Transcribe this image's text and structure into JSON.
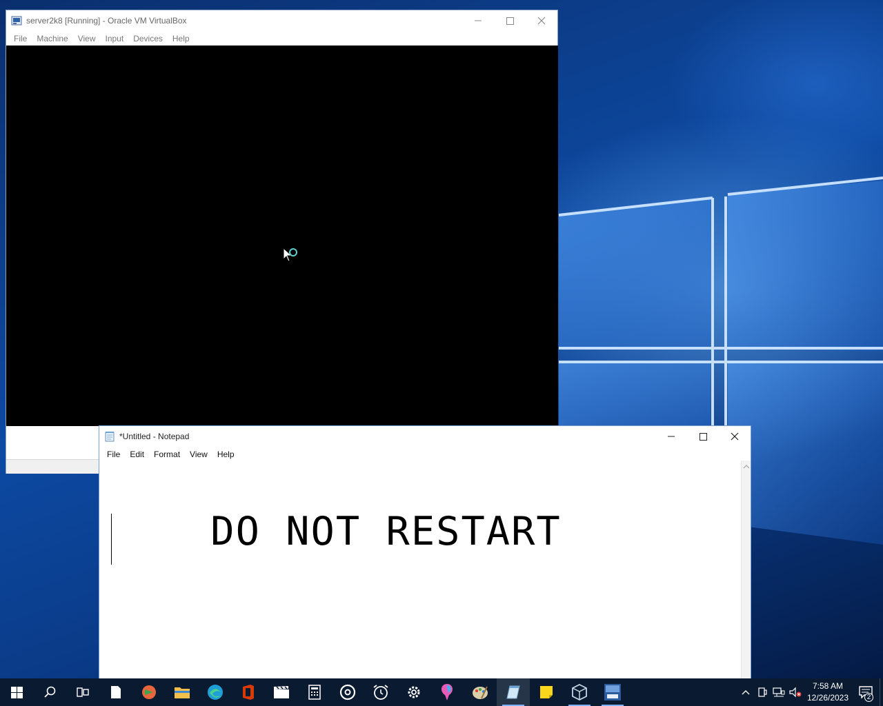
{
  "vbox": {
    "title": "server2k8 [Running] - Oracle VM VirtualBox",
    "menu": [
      "File",
      "Machine",
      "View",
      "Input",
      "Devices",
      "Help"
    ]
  },
  "notepad": {
    "title": "*Untitled - Notepad",
    "menu": [
      "File",
      "Edit",
      "Format",
      "View",
      "Help"
    ],
    "content": "DO NOT RESTART"
  },
  "taskbar": {
    "apps": [
      "windows-start-icon",
      "search-icon",
      "task-view-icon",
      "blank-file-icon",
      "sublime-icon",
      "file-explorer-icon",
      "edge-icon",
      "office-icon",
      "movies-tv-icon",
      "calculator-icon",
      "groove-icon",
      "alarms-clock-icon",
      "settings-icon",
      "paint3d-icon",
      "paint-icon",
      "notepad-icon",
      "sticky-notes-icon",
      "virtualbox-icon",
      "server2008-icon"
    ],
    "clock_time": "7:58 AM",
    "clock_date": "12/26/2023",
    "notification_count": "2"
  },
  "colors": {
    "accent": "#1e78d7",
    "taskbar": "#0a1a30",
    "wallpaper": "#0d4aa3"
  }
}
